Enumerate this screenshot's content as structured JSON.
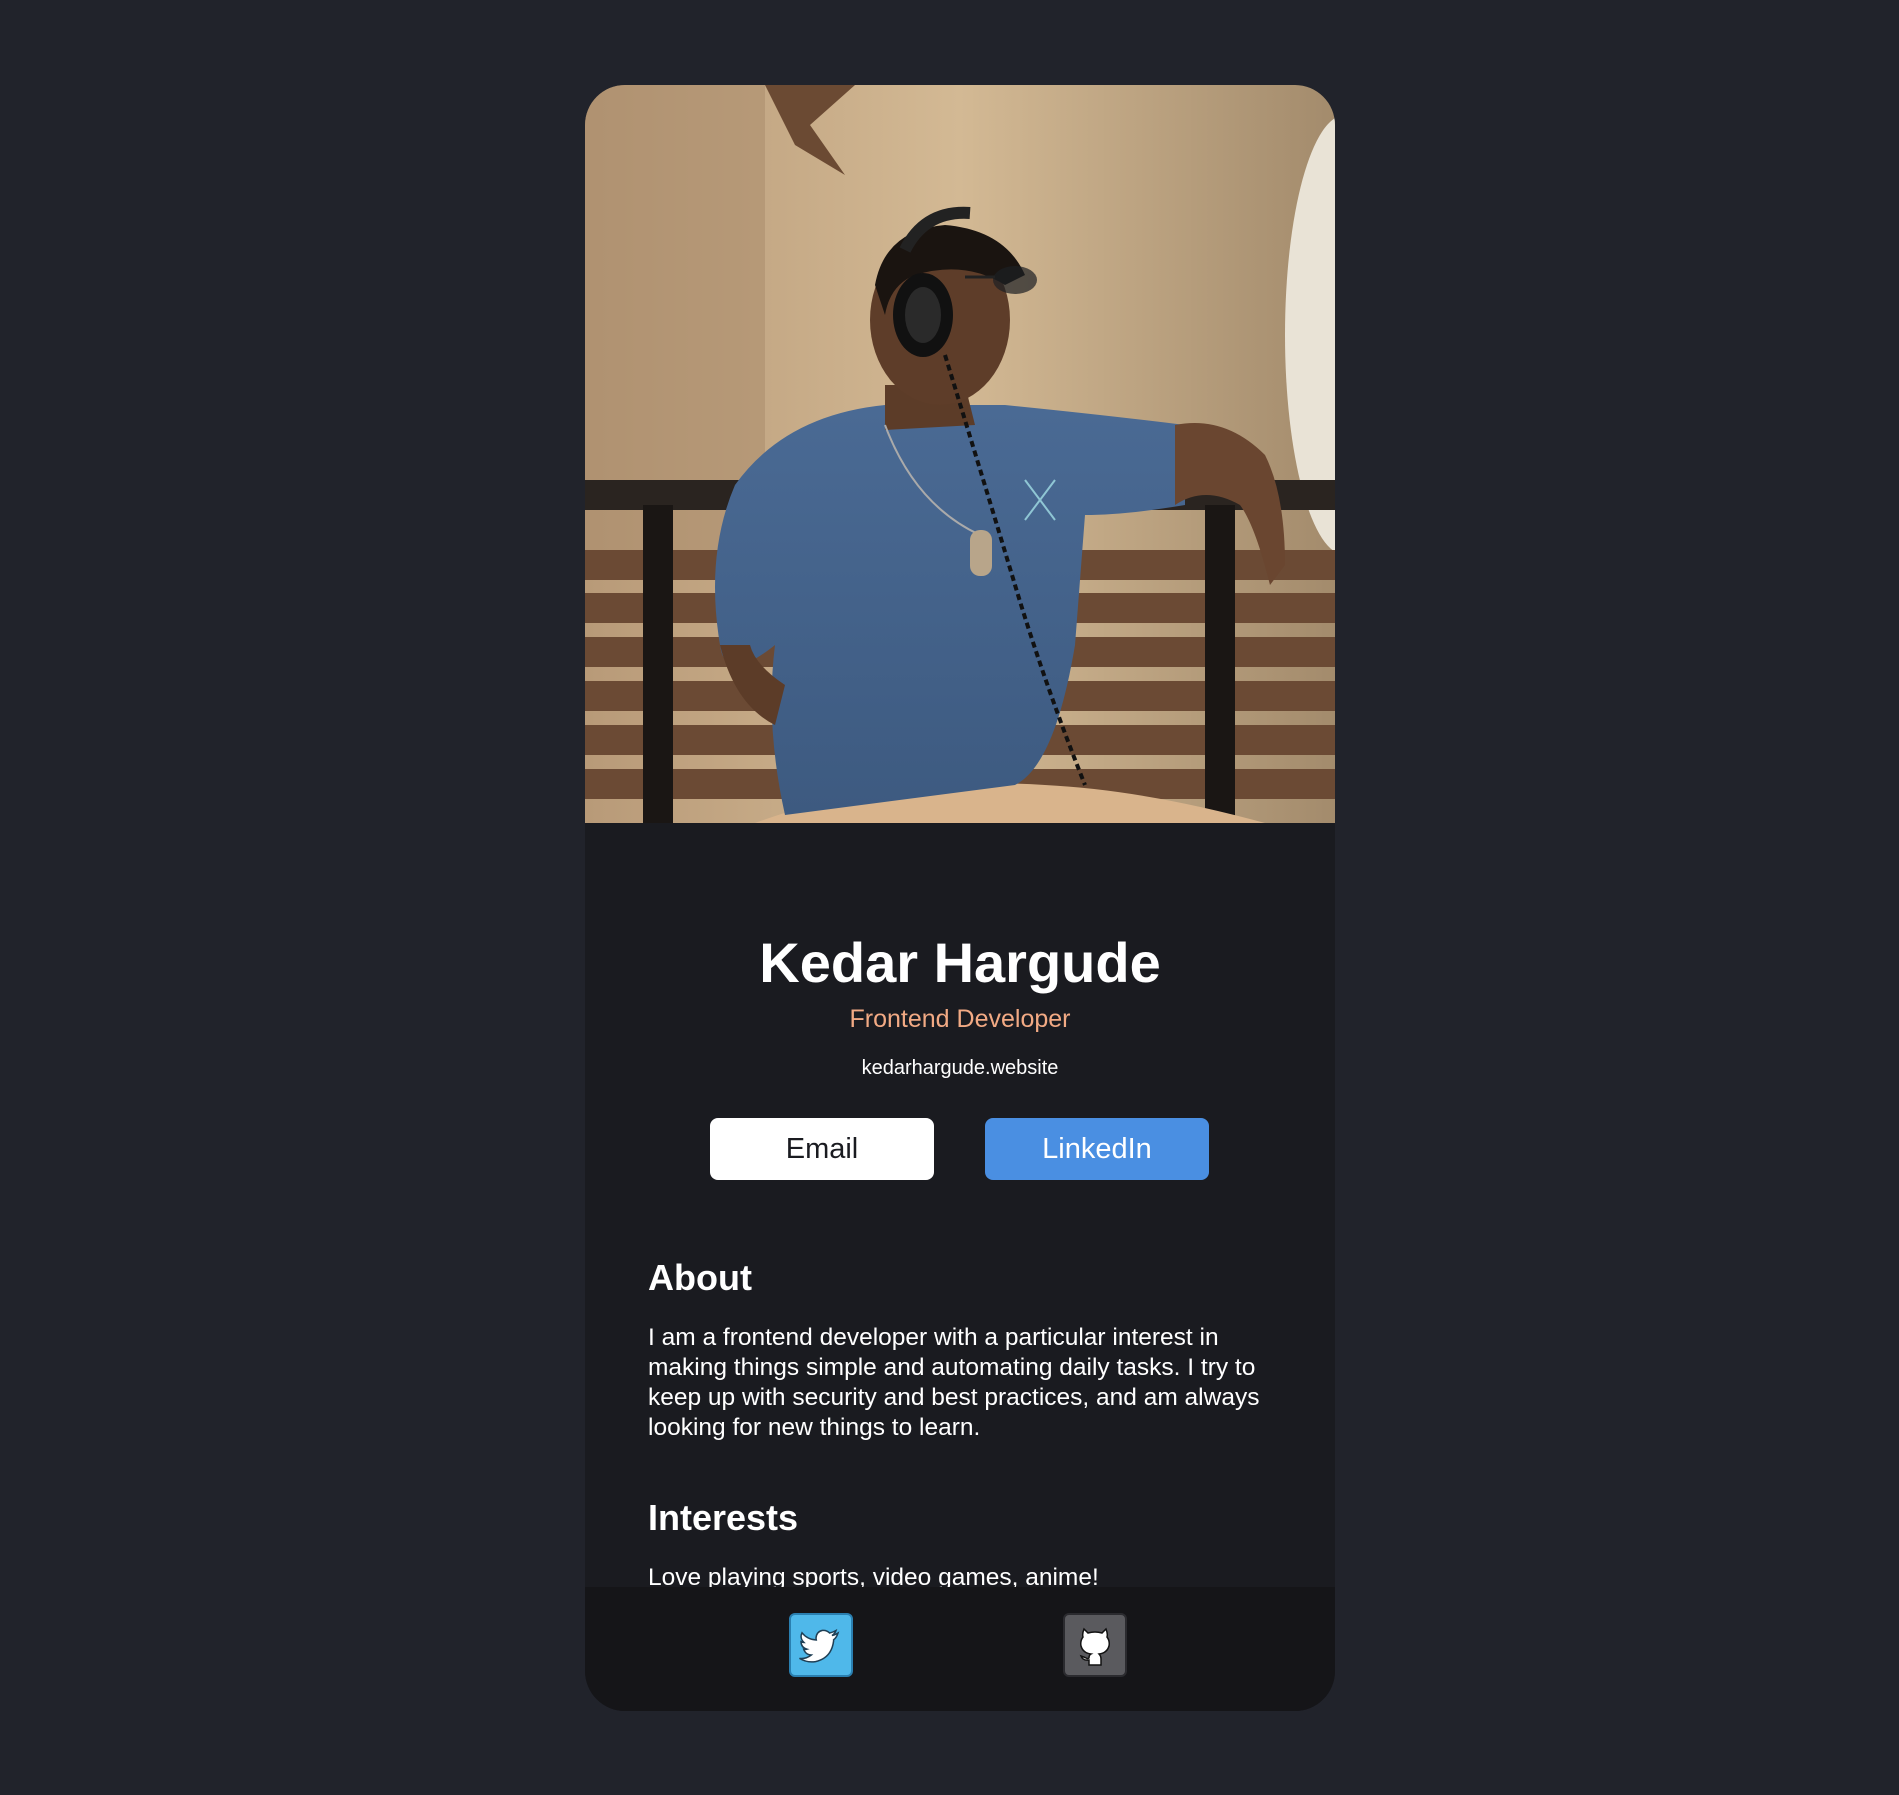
{
  "profile": {
    "name": "Kedar Hargude",
    "role": "Frontend Developer",
    "website": "kedarhargude.website",
    "photo_icon": "profile-photo"
  },
  "actions": {
    "email_label": "Email",
    "linkedin_label": "LinkedIn"
  },
  "about": {
    "title": "About",
    "text": "I am a frontend developer with a particular interest in making things simple and automating daily tasks. I try to keep up with security and best practices, and am always looking for new things to learn."
  },
  "interests": {
    "title": "Interests",
    "text": "Love playing sports, video games, anime!"
  },
  "footer": {
    "links": [
      {
        "icon": "twitter-icon"
      },
      {
        "icon": "github-icon"
      }
    ]
  },
  "colors": {
    "page_background": "#21232b",
    "card_background": "#1a1b20",
    "footer_background": "#151518",
    "role_accent": "#f2aa84",
    "linkedin_blue": "#4a8fe2",
    "twitter_blue": "#4fb8ea",
    "github_gray": "#5a5a5e"
  }
}
